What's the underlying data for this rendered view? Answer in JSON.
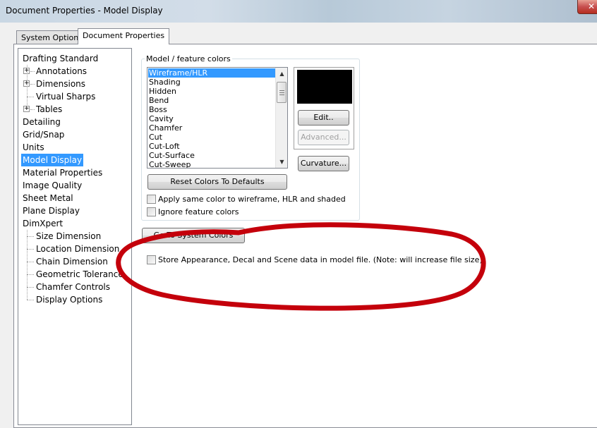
{
  "window": {
    "title": "Document Properties - Model Display",
    "close_glyph": "✕"
  },
  "tabs": [
    {
      "label": "System Options",
      "active": false
    },
    {
      "label": "Document Properties",
      "active": true
    }
  ],
  "tree": [
    {
      "label": "Drafting Standard",
      "level": 0,
      "expandable": false,
      "selected": false
    },
    {
      "label": "Annotations",
      "level": 1,
      "expandable": true,
      "selected": false
    },
    {
      "label": "Dimensions",
      "level": 1,
      "expandable": true,
      "selected": false
    },
    {
      "label": "Virtual Sharps",
      "level": 1,
      "expandable": false,
      "selected": false
    },
    {
      "label": "Tables",
      "level": 1,
      "expandable": true,
      "selected": false
    },
    {
      "label": "Detailing",
      "level": 0,
      "expandable": false,
      "selected": false
    },
    {
      "label": "Grid/Snap",
      "level": 0,
      "expandable": false,
      "selected": false
    },
    {
      "label": "Units",
      "level": 0,
      "expandable": false,
      "selected": false
    },
    {
      "label": "Model Display",
      "level": 0,
      "expandable": false,
      "selected": true
    },
    {
      "label": "Material Properties",
      "level": 0,
      "expandable": false,
      "selected": false
    },
    {
      "label": "Image Quality",
      "level": 0,
      "expandable": false,
      "selected": false
    },
    {
      "label": "Sheet Metal",
      "level": 0,
      "expandable": false,
      "selected": false
    },
    {
      "label": "Plane Display",
      "level": 0,
      "expandable": false,
      "selected": false
    },
    {
      "label": "DimXpert",
      "level": 0,
      "expandable": false,
      "selected": false
    },
    {
      "label": "Size Dimension",
      "level": 1,
      "expandable": false,
      "selected": false
    },
    {
      "label": "Location Dimension",
      "level": 1,
      "expandable": false,
      "selected": false
    },
    {
      "label": "Chain Dimension",
      "level": 1,
      "expandable": false,
      "selected": false
    },
    {
      "label": "Geometric Tolerance",
      "level": 1,
      "expandable": false,
      "selected": false
    },
    {
      "label": "Chamfer Controls",
      "level": 1,
      "expandable": false,
      "selected": false
    },
    {
      "label": "Display Options",
      "level": 1,
      "expandable": false,
      "selected": false
    }
  ],
  "colors_group": {
    "title": "Model / feature colors",
    "items": [
      {
        "label": "Wireframe/HLR",
        "selected": true
      },
      {
        "label": "Shading",
        "selected": false
      },
      {
        "label": "Hidden",
        "selected": false
      },
      {
        "label": "Bend",
        "selected": false
      },
      {
        "label": "Boss",
        "selected": false
      },
      {
        "label": "Cavity",
        "selected": false
      },
      {
        "label": "Chamfer",
        "selected": false
      },
      {
        "label": "Cut",
        "selected": false
      },
      {
        "label": "Cut-Loft",
        "selected": false
      },
      {
        "label": "Cut-Surface",
        "selected": false
      },
      {
        "label": "Cut-Sweep",
        "selected": false
      }
    ],
    "swatch_color": "#000000",
    "edit_button": "Edit..",
    "advanced_button": "Advanced...",
    "curvature_button": "Curvature...",
    "reset_button": "Reset Colors To Defaults",
    "apply_same_color_label": "Apply same color to wireframe, HLR and shaded",
    "ignore_feature_colors_label": "Ignore feature colors"
  },
  "goto_system_colors_button": "Go To System Colors",
  "store_appearance_label": "Store Appearance, Decal and Scene data in model file. (Note: will increase file size)",
  "annotation_color": "#c4000b"
}
